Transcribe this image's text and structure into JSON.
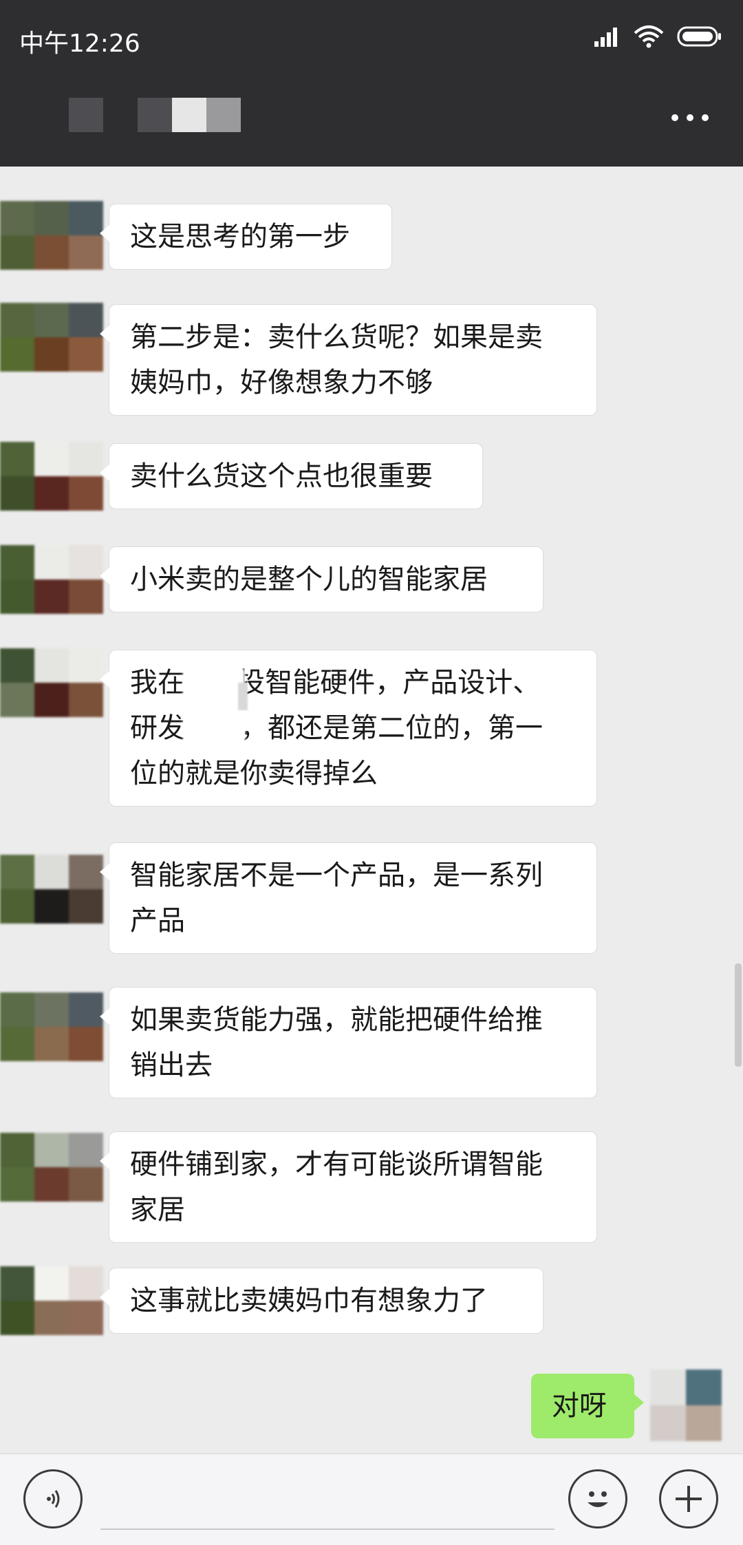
{
  "status": {
    "time": "中午12:26"
  },
  "chat": {
    "messages": [
      {
        "text": "这是思考的第一步"
      },
      {
        "text": "第二步是：卖什么货呢？如果是卖\n姨妈巾，好像想象力不够"
      },
      {
        "text": "卖什么货这个点也很重要"
      },
      {
        "text": "小米卖的是整个儿的智能家居"
      },
      {
        "text": "我在      投智能硬件，产品设计、\n研发之类，都还是第二位的，第一\n位的就是你卖得掉么"
      },
      {
        "text": "智能家居不是一个产品，是一系列\n产品"
      },
      {
        "text": "如果卖货能力强，就能把硬件给推\n销出去"
      },
      {
        "text": "硬件铺到家，才有可能谈所谓智能\n家居"
      },
      {
        "text": "这事就比卖姨妈巾有想象力了"
      }
    ],
    "my_message": "对呀"
  },
  "icons": {
    "voice": "voice-icon",
    "emoji": "emoji-icon",
    "more": "plus-icon",
    "menu": "more-dots-icon"
  },
  "colors": {
    "header": "#2e2e31",
    "chat_bg": "#ececec",
    "my_bubble": "#9eea6a"
  }
}
